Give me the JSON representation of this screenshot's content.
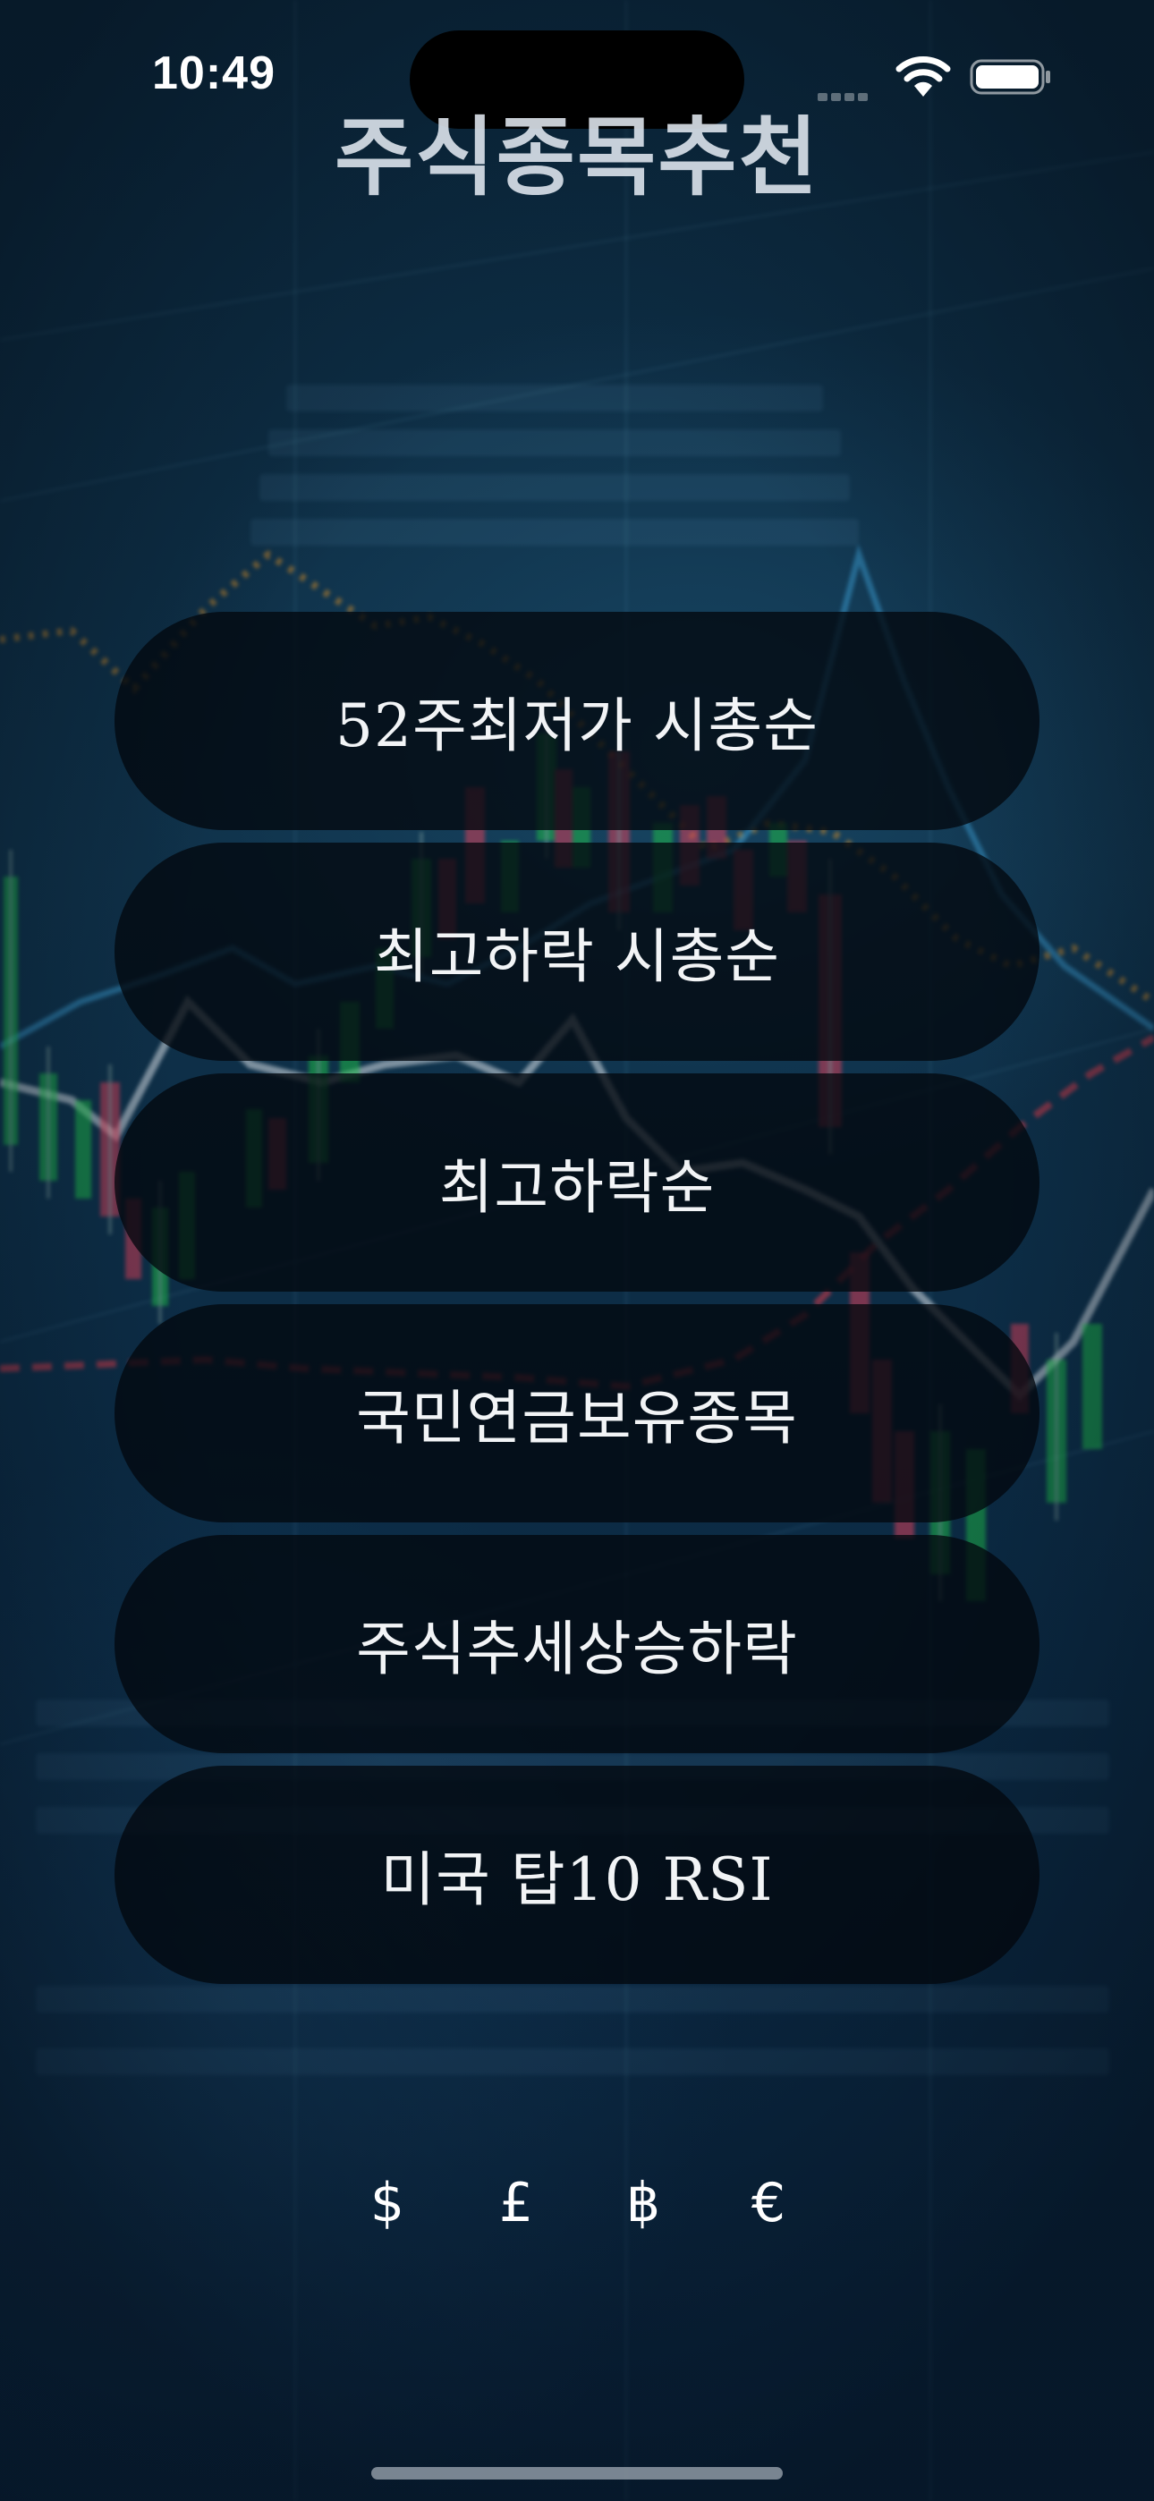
{
  "status_bar": {
    "time": "10:49"
  },
  "title": "주식종목추천",
  "menu": [
    {
      "label": "52주최저가 시총순"
    },
    {
      "label": "최고하락 시총순"
    },
    {
      "label": "최고하락순"
    },
    {
      "label": "국민연금보유종목"
    },
    {
      "label": "주식추세상승하락"
    },
    {
      "label": "미국 탑10 RSI"
    }
  ],
  "currencies": [
    {
      "symbol": "$",
      "icon": "dollar-icon"
    },
    {
      "symbol": "£",
      "icon": "pound-icon"
    },
    {
      "symbol": "฿",
      "icon": "baht-icon"
    },
    {
      "symbol": "€",
      "icon": "euro-icon"
    }
  ],
  "colors": {
    "background": "#0b2238",
    "button": "#02080e",
    "text": "#f2f4f6",
    "candle_up": "#1fbf4a",
    "candle_down": "#e0405a",
    "trend_orange": "#d08a2a",
    "trend_red": "#d23a4a",
    "trend_blue": "#3a9ad0"
  }
}
